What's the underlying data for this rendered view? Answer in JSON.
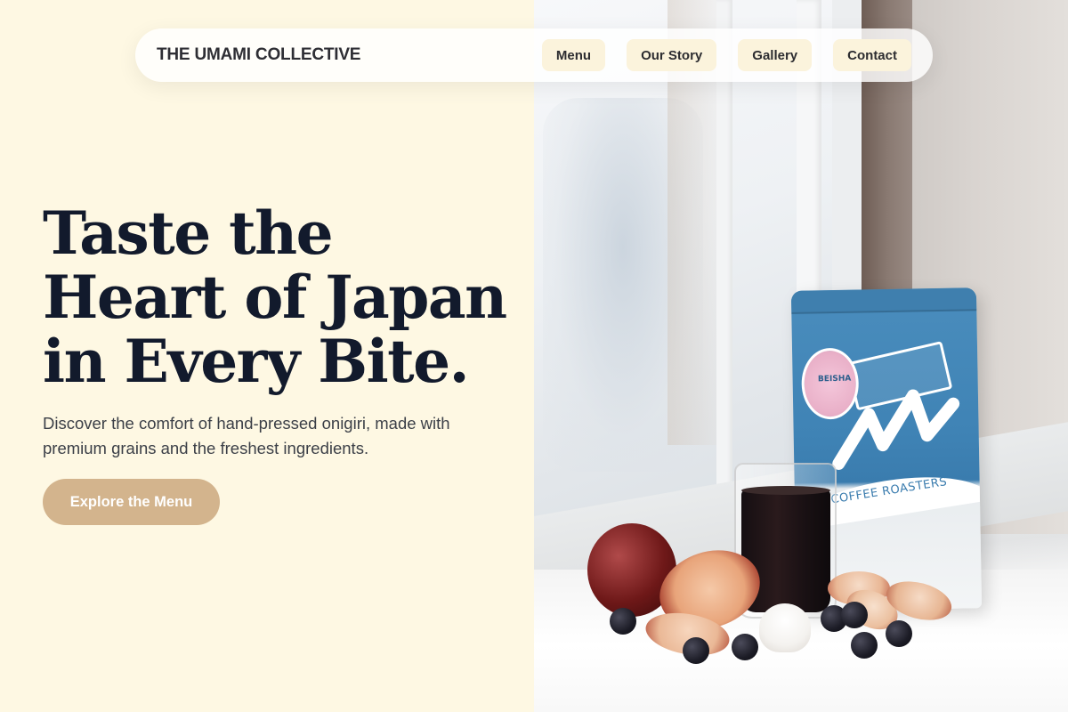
{
  "nav": {
    "brand": "THE UMAMI COLLECTIVE",
    "links": [
      {
        "label": "Menu"
      },
      {
        "label": "Our Story"
      },
      {
        "label": "Gallery"
      },
      {
        "label": "Contact"
      }
    ]
  },
  "hero": {
    "title_lines": [
      "Taste the",
      "Heart of Japan",
      "in Every Bite."
    ],
    "subtitle": "Discover the comfort of hand-pressed onigiri, made with premium grains and the freshest ingredients.",
    "cta_label": "Explore the Menu"
  },
  "photo": {
    "bag_label": "COFFEE ROASTERS",
    "sticker_text": "BEISHA"
  },
  "colors": {
    "background": "#fef8e3",
    "nav_button": "#fbf3dc",
    "cta": "#d3b48d",
    "heading": "#121a2c"
  }
}
